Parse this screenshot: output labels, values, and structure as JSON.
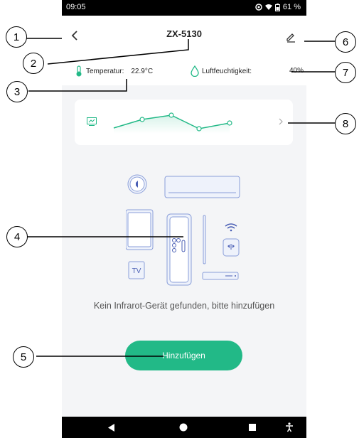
{
  "status_bar": {
    "time": "09:05",
    "battery": "61 %"
  },
  "header": {
    "back_icon": "chevron-left-icon",
    "title": "ZX-5130",
    "edit_icon": "pencil-icon"
  },
  "sensors": {
    "temperature": {
      "label": "Temperatur:",
      "value": "22.9°C",
      "icon": "thermometer-icon"
    },
    "humidity": {
      "label": "Luftfeuchtigkeit:",
      "value": "40%",
      "icon": "water-drop-icon"
    }
  },
  "chart_card": {
    "icon": "chart-icon",
    "chevron_icon": "chevron-right-icon",
    "line_color": "#22b987"
  },
  "empty_state": {
    "message": "Kein Infrarot-Gerät gefunden, bitte hinzufügen"
  },
  "add_button": {
    "label": "Hinzufügen",
    "color": "#22b987"
  },
  "callouts": [
    "1",
    "2",
    "3",
    "4",
    "5",
    "6",
    "7",
    "8"
  ]
}
